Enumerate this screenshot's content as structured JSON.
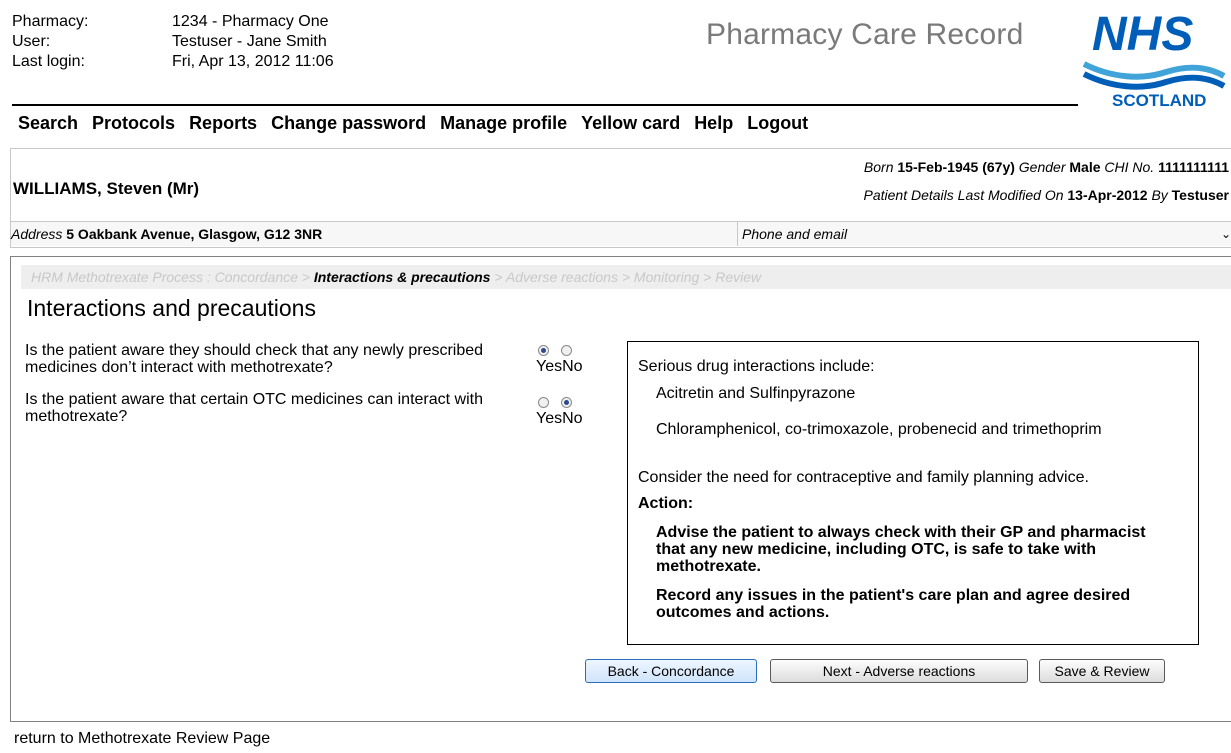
{
  "header": {
    "pharmacy_label": "Pharmacy:",
    "pharmacy_value": "1234 - Pharmacy One",
    "user_label": "User:",
    "user_value": "Testuser - Jane Smith",
    "last_login_label": "Last login:",
    "last_login_value": "Fri, Apr 13, 2012 11:06",
    "app_title": "Pharmacy Care Record",
    "logo_nhs": "NHS",
    "logo_scotland": "SCOTLAND"
  },
  "nav": [
    "Search",
    "Protocols",
    "Reports",
    "Change password",
    "Manage profile",
    "Yellow card",
    "Help",
    "Logout"
  ],
  "patient": {
    "name": "WILLIAMS, Steven (Mr)",
    "born_label": "Born",
    "born_value": "15-Feb-1945",
    "age": "(67y)",
    "gender_label": "Gender",
    "gender_value": "Male",
    "chi_label": "CHI No.",
    "chi_value": "1111111111",
    "modified_label": "Patient Details Last Modified On",
    "modified_date": "13-Apr-2012",
    "by_label": "By",
    "modified_by": "Testuser",
    "address_label": "Address",
    "address_value": "5 Oakbank Avenue, Glasgow, G12 3NR",
    "phone_label": "Phone and email"
  },
  "breadcrumb": {
    "step1": "HRM Methotrexate Process : Concordance",
    "sep": " > ",
    "current": "Interactions & precautions",
    "step3": "Adverse reactions",
    "step4": "Monitoring",
    "step5": "Review"
  },
  "section_title": "Interactions and precautions",
  "questions": [
    {
      "text": "Is the patient aware they should check that any newly prescribed medicines don’t interact with methotrexate?",
      "yes": "Yes",
      "no": "No",
      "selected": "Yes"
    },
    {
      "text": "Is the patient aware that certain OTC medicines can interact with methotrexate?",
      "yes": "Yes",
      "no": "No",
      "selected": "No"
    }
  ],
  "info": {
    "heading": "Serious drug interactions include:",
    "item1": "Acitretin and Sulfinpyrazone",
    "item2": "Chloramphenicol, co-trimoxazole, probenecid and trimethoprim",
    "contraceptive": "Consider the need for contraceptive and family planning advice.",
    "action_label": "Action:",
    "action1": "Advise the patient to always check with their GP and pharmacist that any new medicine, including OTC, is safe to take with methotrexate.",
    "action2": "Record any issues in the patient's care plan and agree desired outcomes and actions."
  },
  "buttons": {
    "back": "Back - Concordance",
    "next": "Next - Adverse reactions",
    "save": "Save & Review"
  },
  "footer_link": "return to Methotrexate Review Page",
  "colors": {
    "nhs_blue": "#005eb8",
    "wave_blue": "#41a4d8",
    "breadcrumb_inactive": "#c8c8c8"
  }
}
